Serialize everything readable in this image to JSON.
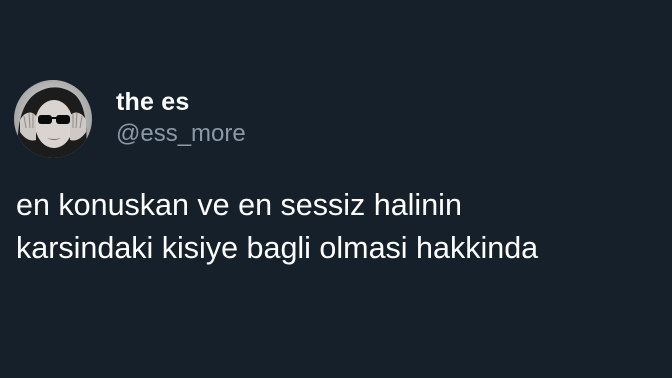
{
  "tweet": {
    "author": {
      "display_name": "the es",
      "handle": "@ess_more",
      "avatar_icon": "profile-photo-woman-sunglasses"
    },
    "text_lines": [
      "en konuskan ve en sessiz halinin",
      "karsindaki kisiye bagli olmasi hakkinda"
    ]
  },
  "theme": {
    "background": "#15202b",
    "primary_text": "#ffffff",
    "secondary_text": "#8b98a5"
  }
}
